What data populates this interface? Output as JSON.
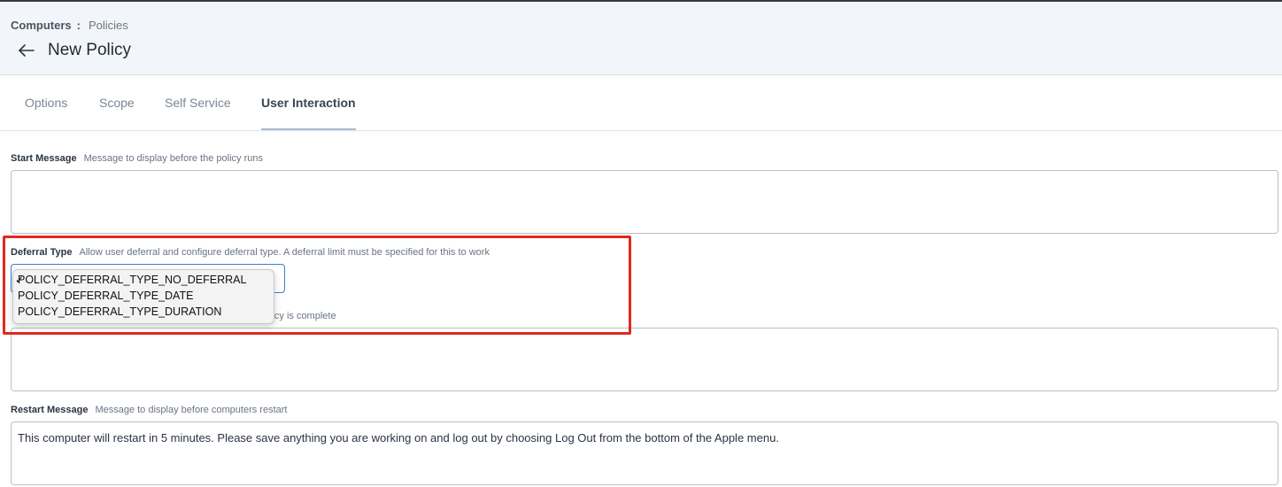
{
  "breadcrumb": {
    "root": "Computers",
    "separator": ":",
    "current": "Policies"
  },
  "page": {
    "title": "New Policy",
    "back_icon": "arrow-left-icon"
  },
  "tabs": [
    {
      "label": "Options",
      "active": false
    },
    {
      "label": "Scope",
      "active": false
    },
    {
      "label": "Self Service",
      "active": false
    },
    {
      "label": "User Interaction",
      "active": true
    }
  ],
  "start_message": {
    "label": "Start Message",
    "help": "Message to display before the policy runs",
    "value": ""
  },
  "deferral_type": {
    "label": "Deferral Type",
    "help": "Allow user deferral and configure deferral type. A deferral limit must be specified for this to work",
    "selected": "POLICY_DEFERRAL_TYPE_NO_DEFERRAL",
    "options": [
      {
        "label": "POLICY_DEFERRAL_TYPE_NO_DEFERRAL",
        "checked": true
      },
      {
        "label": "POLICY_DEFERRAL_TYPE_DATE",
        "checked": false
      },
      {
        "label": "POLICY_DEFERRAL_TYPE_DURATION",
        "checked": false
      }
    ],
    "checkmark": "✓"
  },
  "complete_message": {
    "visible_help_fragment": "licy is complete",
    "value": ""
  },
  "restart_message": {
    "label": "Restart Message",
    "help": "Message to display before computers restart",
    "value": "This computer will restart in 5 minutes. Please save anything you are working on and log out by choosing Log Out from the bottom of the Apple menu."
  },
  "colors": {
    "header_bg": "#f2f6fa",
    "focus_border": "#3d7bd6",
    "annotation_red": "#e02a1e",
    "active_tab_underline": "#a9b7d3"
  }
}
